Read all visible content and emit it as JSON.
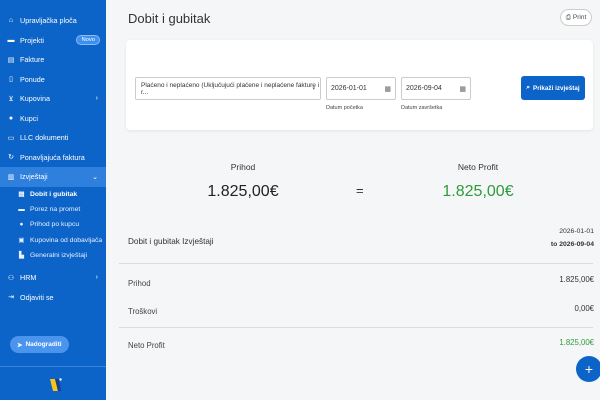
{
  "sidebar": {
    "items": [
      {
        "label": "Upravljačka ploča",
        "icon": "home-icon"
      },
      {
        "label": "Projekti",
        "icon": "folder-icon",
        "badge": "Novo"
      },
      {
        "label": "Fakture",
        "icon": "invoice-icon"
      },
      {
        "label": "Ponude",
        "icon": "file-icon"
      },
      {
        "label": "Kupovina",
        "icon": "cart-icon"
      },
      {
        "label": "Kupci",
        "icon": "user-icon"
      },
      {
        "label": "LLC dokumenti",
        "icon": "document-icon"
      },
      {
        "label": "Ponavljajuća faktura",
        "icon": "recurring-icon"
      },
      {
        "label": "Izvještaji",
        "icon": "report-icon"
      }
    ],
    "sub_items": [
      {
        "label": "Dobit i gubitak",
        "icon": "document-icon"
      },
      {
        "label": "Porez na promet",
        "icon": "folder-icon"
      },
      {
        "label": "Prihod po kupcu",
        "icon": "user-icon"
      },
      {
        "label": "Kupovina od dobavljača",
        "icon": "truck-icon"
      },
      {
        "label": "Generalni izvještaji",
        "icon": "bar-chart-icon"
      }
    ],
    "bottom_items": [
      {
        "label": "HRM",
        "icon": "people-icon"
      },
      {
        "label": "Odjaviti se",
        "icon": "logout-icon"
      }
    ],
    "upgrade_label": "Nadograditi"
  },
  "header": {
    "title": "Dobit i gubitak",
    "print_label": "Print"
  },
  "filters": {
    "status_select": "Plaćeno i neplaćeno (Uključujući plaćene i neplaćene fakture i r...",
    "start_date": "2026-01-01",
    "start_label": "Datum početka",
    "end_date": "2026-09-04",
    "end_label": "Datum završetka",
    "show_button": "Prikaži izvještaj"
  },
  "summary": {
    "income_label": "Prihod",
    "income_value": "1.825,00€",
    "equals": "=",
    "profit_label": "Neto Profit",
    "profit_value": "1.825,00€"
  },
  "report": {
    "title": "Dobit i gubitak Izvještaji",
    "period_from": "2026-01-01",
    "period_to": "to 2026-09-04",
    "rows": [
      {
        "label": "Prihod",
        "value": "1.825,00€"
      },
      {
        "label": "Troškovi",
        "value": "0,00€"
      },
      {
        "label": "Neto Profit",
        "value": "1.825,00€"
      }
    ]
  },
  "colors": {
    "primary": "#0d64c8",
    "profit_green": "#2e9c3a"
  }
}
